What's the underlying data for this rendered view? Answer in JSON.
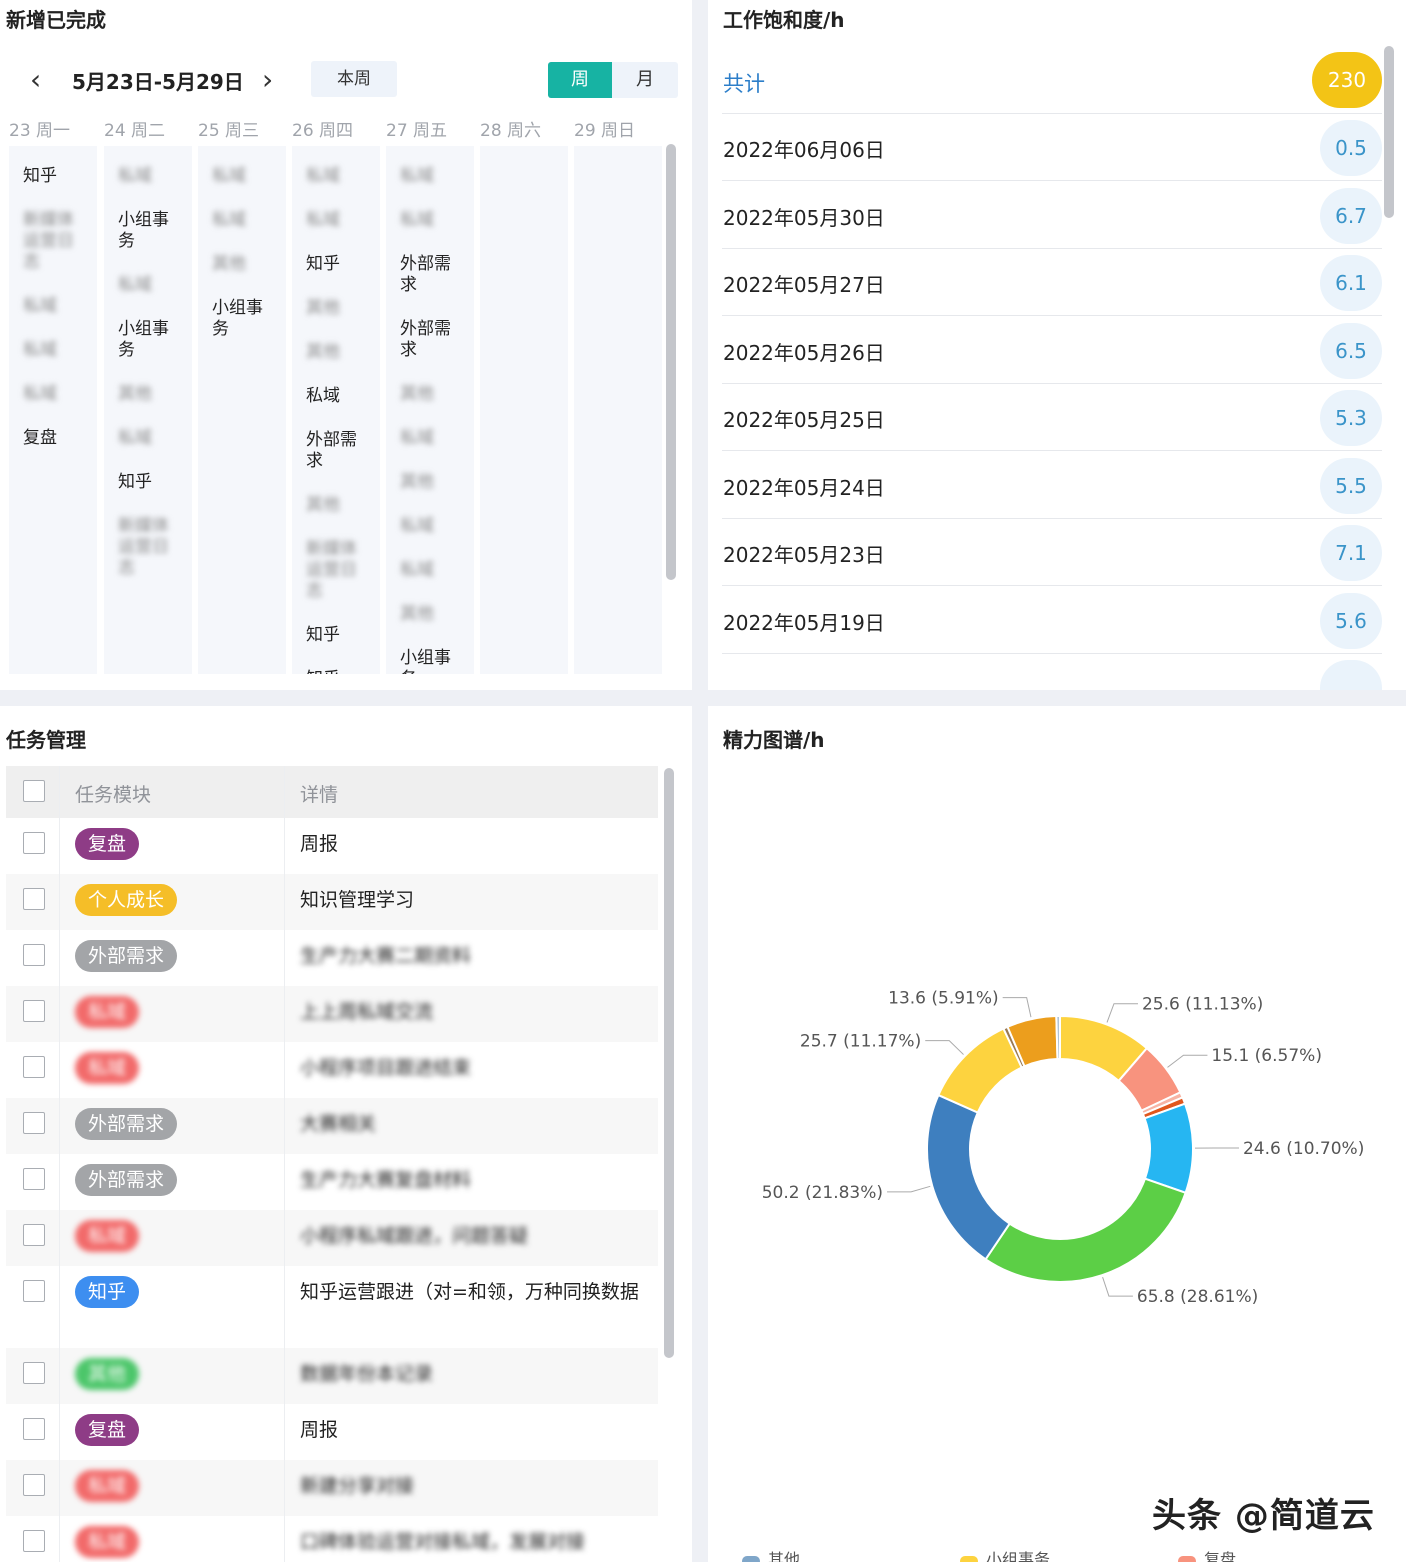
{
  "week_panel": {
    "title": "新增已完成",
    "date_range": "5月23日-5月29日",
    "this_week": "本周",
    "view_week": "周",
    "view_month": "月",
    "prev_icon": "chevron-left-icon",
    "next_icon": "chevron-right-icon",
    "days": [
      {
        "label": "23 周一",
        "items": [
          {
            "t": "知乎",
            "b": false
          },
          {
            "t": "新媒体运营日志",
            "b": true
          },
          {
            "t": "私域",
            "b": true
          },
          {
            "t": "私域",
            "b": true
          },
          {
            "t": "私域",
            "b": true
          },
          {
            "t": "复盘",
            "b": false
          }
        ]
      },
      {
        "label": "24 周二",
        "items": [
          {
            "t": "私域",
            "b": true
          },
          {
            "t": "小组事务",
            "b": false
          },
          {
            "t": "私域",
            "b": true
          },
          {
            "t": "小组事务",
            "b": false
          },
          {
            "t": "其他",
            "b": true
          },
          {
            "t": "私域",
            "b": true
          },
          {
            "t": "知乎",
            "b": false
          },
          {
            "t": "新媒体运营日志",
            "b": true
          }
        ]
      },
      {
        "label": "25 周三",
        "items": [
          {
            "t": "私域",
            "b": true
          },
          {
            "t": "私域",
            "b": true
          },
          {
            "t": "其他",
            "b": true
          },
          {
            "t": "小组事务",
            "b": false
          }
        ]
      },
      {
        "label": "26 周四",
        "items": [
          {
            "t": "私域",
            "b": true
          },
          {
            "t": "私域",
            "b": true
          },
          {
            "t": "知乎",
            "b": false
          },
          {
            "t": "其他",
            "b": true
          },
          {
            "t": "其他",
            "b": true
          },
          {
            "t": "私域",
            "b": false
          },
          {
            "t": "外部需求",
            "b": false
          },
          {
            "t": "其他",
            "b": true
          },
          {
            "t": "新媒体运营日志",
            "b": true
          },
          {
            "t": "知乎",
            "b": false
          },
          {
            "t": "知乎",
            "b": false
          }
        ]
      },
      {
        "label": "27 周五",
        "items": [
          {
            "t": "私域",
            "b": true
          },
          {
            "t": "私域",
            "b": true
          },
          {
            "t": "外部需求",
            "b": false
          },
          {
            "t": "外部需求",
            "b": false
          },
          {
            "t": "其他",
            "b": true
          },
          {
            "t": "私域",
            "b": true
          },
          {
            "t": "其他",
            "b": true
          },
          {
            "t": "私域",
            "b": true
          },
          {
            "t": "私域",
            "b": true
          },
          {
            "t": "其他",
            "b": true
          },
          {
            "t": "小组事务",
            "b": false
          }
        ]
      },
      {
        "label": "28 周六",
        "items": []
      },
      {
        "label": "29 周日",
        "items": []
      }
    ]
  },
  "saturation_panel": {
    "title": "工作饱和度/h",
    "total_label": "共计",
    "total_value": "230",
    "rows": [
      {
        "date": "2022年06月06日",
        "value": "0.5"
      },
      {
        "date": "2022年05月30日",
        "value": "6.7"
      },
      {
        "date": "2022年05月27日",
        "value": "6.1"
      },
      {
        "date": "2022年05月26日",
        "value": "6.5"
      },
      {
        "date": "2022年05月25日",
        "value": "5.3"
      },
      {
        "date": "2022年05月24日",
        "value": "5.5"
      },
      {
        "date": "2022年05月23日",
        "value": "7.1"
      },
      {
        "date": "2022年05月19日",
        "value": "5.6"
      }
    ]
  },
  "task_panel": {
    "title": "任务管理",
    "col_module": "任务模块",
    "col_detail": "详情",
    "rows": [
      {
        "tag": "复盘",
        "color": "#8e3c86",
        "detail": "周报",
        "blur": false
      },
      {
        "tag": "个人成长",
        "color": "#f5be28",
        "detail": "知识管理学习",
        "blur": false
      },
      {
        "tag": "外部需求",
        "color": "#a3a5a8",
        "detail": "生产力大赛二期资料",
        "blur": true
      },
      {
        "tag": "私域",
        "color": "#f26a6a",
        "detail": "上上周私域交流",
        "blur": true
      },
      {
        "tag": "私域",
        "color": "#f26a6a",
        "detail": "小程序项目跟进结束",
        "blur": true
      },
      {
        "tag": "外部需求",
        "color": "#a3a5a8",
        "detail": "大赛相关",
        "blur": true
      },
      {
        "tag": "外部需求",
        "color": "#a3a5a8",
        "detail": "生产力大赛复盘材料",
        "blur": true
      },
      {
        "tag": "私域",
        "color": "#f26a6a",
        "detail": "小程序私域跟进，问题答疑",
        "blur": true
      },
      {
        "tag": "知乎",
        "color": "#3d8ef0",
        "detail": "知乎运营跟进（对=和领，万种同换数据",
        "blur": false
      },
      {
        "tag": "其他",
        "color": "#4cc66a",
        "detail": "数据年份本记录",
        "blur": true
      },
      {
        "tag": "复盘",
        "color": "#8e3c86",
        "detail": "周报",
        "blur": false
      },
      {
        "tag": "私域",
        "color": "#f26a6a",
        "detail": "新建分享对接",
        "blur": true
      },
      {
        "tag": "私域",
        "color": "#f26a6a",
        "detail": "口碑体验运营对接私域，发展对接",
        "blur": true
      }
    ]
  },
  "energy_panel": {
    "title": "精力图谱/h",
    "watermark": "头条 @简道云",
    "chart_data": {
      "type": "pie",
      "subtype": "donut",
      "slices": [
        {
          "name": "小组事务",
          "value": 25.6,
          "label": "25.6 (11.13%)",
          "color": "#fdd33f"
        },
        {
          "name": "复盘",
          "value": 15.1,
          "label": "15.1 (6.57%)",
          "color": "#f8937e"
        },
        {
          "name": "",
          "value": 1.5,
          "label": "",
          "color": "#f7b4a4"
        },
        {
          "name": "",
          "value": 1.8,
          "label": "",
          "color": "#e1571d"
        },
        {
          "name": "",
          "value": 24.6,
          "label": "24.6 (10.70%)",
          "color": "#26b6f2"
        },
        {
          "name": "",
          "value": 65.8,
          "label": "65.8 (28.61%)",
          "color": "#5ccf46"
        },
        {
          "name": "",
          "value": 50.2,
          "label": "50.2 (21.83%)",
          "color": "#3e7fbf"
        },
        {
          "name": "",
          "value": 25.7,
          "label": "25.7 (11.17%)",
          "color": "#fdd33f"
        },
        {
          "name": "",
          "value": 1.2,
          "label": "",
          "color": "#9a7a52"
        },
        {
          "name": "",
          "value": 13.6,
          "label": "13.6 (5.91%)",
          "color": "#ec9e1d"
        },
        {
          "name": "",
          "value": 1.0,
          "label": "",
          "color": "#b0c4d8"
        }
      ],
      "legend": [
        {
          "name": "其他",
          "color": "#7fa6c9"
        },
        {
          "name": "小组事务",
          "color": "#fdd33f"
        },
        {
          "name": "复盘",
          "color": "#f8937e"
        }
      ]
    }
  }
}
